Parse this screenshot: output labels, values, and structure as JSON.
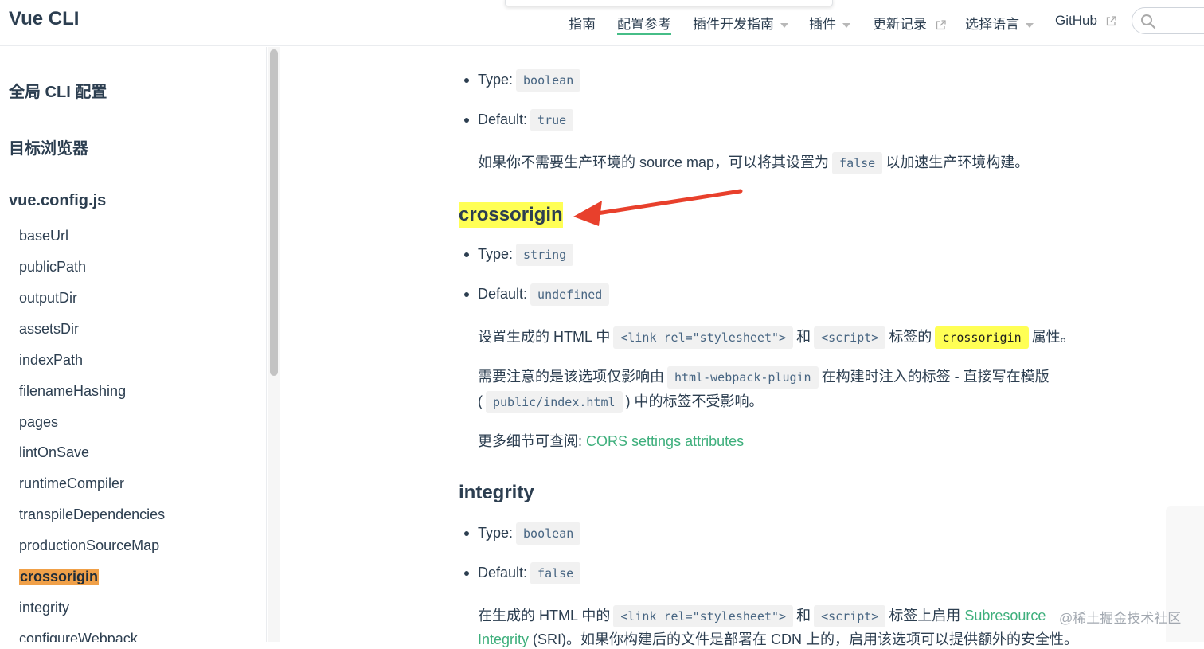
{
  "navbar": {
    "logo": "Vue CLI",
    "items": [
      {
        "label": "指南"
      },
      {
        "label": "配置参考"
      },
      {
        "label": "插件开发指南"
      },
      {
        "label": "插件"
      },
      {
        "label": "更新记录"
      },
      {
        "label": "选择语言"
      },
      {
        "label": "GitHub"
      }
    ]
  },
  "sidebar": {
    "groups": [
      "全局 CLI 配置",
      "目标浏览器",
      "vue.config.js"
    ],
    "items": [
      "baseUrl",
      "publicPath",
      "outputDir",
      "assetsDir",
      "indexPath",
      "filenameHashing",
      "pages",
      "lintOnSave",
      "runtimeCompiler",
      "transpileDependencies",
      "productionSourceMap",
      "crossorigin",
      "integrity",
      "configureWebpack"
    ]
  },
  "content": {
    "sm": {
      "type_label": "Type:",
      "type_value": "boolean",
      "default_label": "Default:",
      "default_value": "true",
      "desc_pre": "如果你不需要生产环境的 source map，可以将其设置为",
      "desc_code": "false",
      "desc_post": "以加速生产环境构建。"
    },
    "crossorigin": {
      "heading": "crossorigin",
      "type_label": "Type:",
      "type_value": "string",
      "default_label": "Default:",
      "default_value": "undefined",
      "p1_a": "设置生成的 HTML 中",
      "p1_code1": "<link rel=\"stylesheet\">",
      "p1_b": "和",
      "p1_code2": "<script>",
      "p1_c": "标签的",
      "p1_code3": "crossorigin",
      "p1_d": "属性。",
      "p2_a": "需要注意的是该选项仅影响由",
      "p2_code1": "html-webpack-plugin",
      "p2_b": "在构建时注入的标签 - 直接写在模版",
      "p2_c": "(",
      "p2_code2": "public/index.html",
      "p2_d": ") 中的标签不受影响。",
      "p3_a": "更多细节可查阅:",
      "p3_link": "CORS settings attributes"
    },
    "integrity": {
      "heading": "integrity",
      "type_label": "Type:",
      "type_value": "boolean",
      "default_label": "Default:",
      "default_value": "false",
      "p1_a": "在生成的 HTML 中的",
      "p1_code1": "<link rel=\"stylesheet\">",
      "p1_b": "和",
      "p1_code2": "<script>",
      "p1_c": "标签上启用",
      "p1_link1": "Subresource",
      "p1_link2": "Integrity",
      "p1_d": "(SRI)。如果你构建后的文件是部署在 CDN 上的，启用该选项可以提供额外的安全性。"
    }
  },
  "watermark": "@稀土掘金技术社区",
  "colors": {
    "accent": "#3eaf7c",
    "highlight": "#ffff55",
    "sidebar_active": "#f0a048",
    "arrow": "#e8402c"
  }
}
